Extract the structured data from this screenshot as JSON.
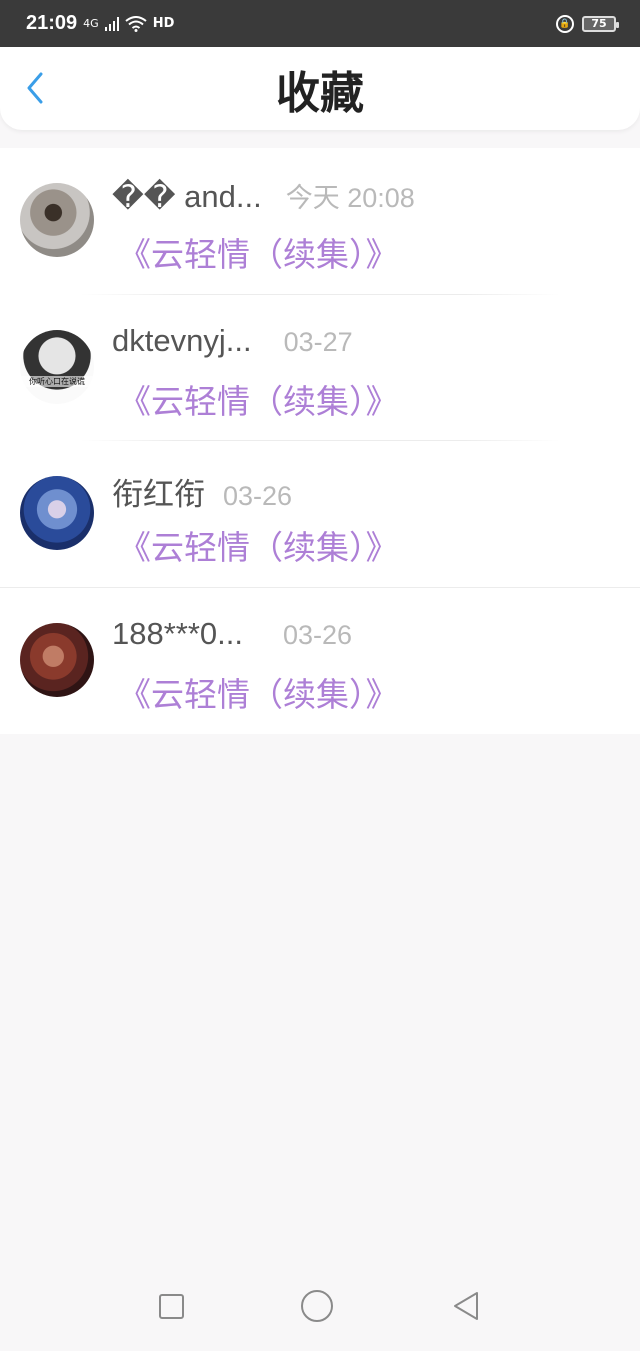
{
  "status_bar": {
    "time": "21:09",
    "network": "4G",
    "hd": "HD",
    "battery": "75"
  },
  "header": {
    "title": "收藏"
  },
  "items": [
    {
      "user": "�� and...",
      "time": "今天 20:08",
      "book": "《云轻情（续集）》"
    },
    {
      "user": "dktevnyj...",
      "time": "03-27",
      "book": "《云轻情（续集）》",
      "avatar_text": "你听心口在说谎"
    },
    {
      "user": "衔红衔",
      "time": "03-26",
      "book": "《云轻情（续集）》"
    },
    {
      "user": "188***0...",
      "time": "03-26",
      "book": "《云轻情（续集）》"
    }
  ],
  "colors": {
    "accent": "#3a9ee8",
    "book_title": "#ad7fd6"
  }
}
